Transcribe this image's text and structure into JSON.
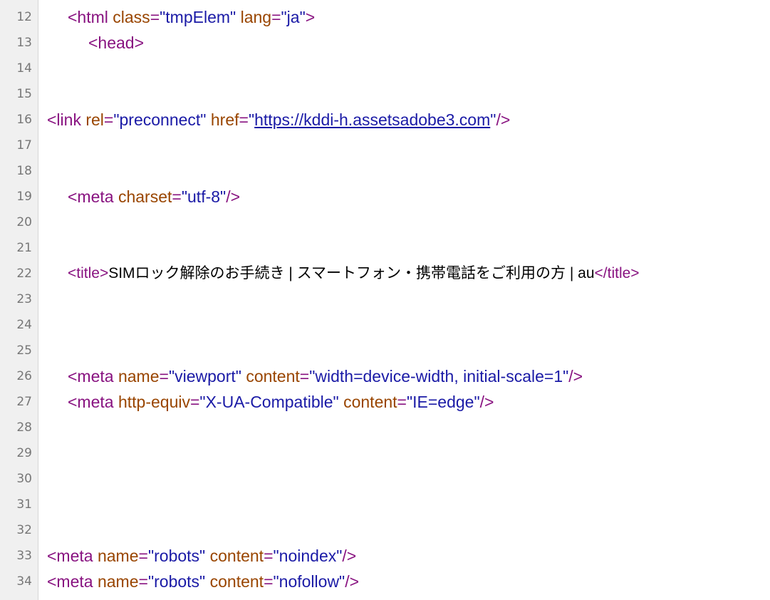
{
  "source": {
    "line_numbers": [
      "12",
      "13",
      "14",
      "15",
      "16",
      "17",
      "18",
      "19",
      "20",
      "21",
      "22",
      "23",
      "24",
      "25",
      "26",
      "27",
      "28",
      "29",
      "30",
      "31",
      "32",
      "33",
      "34"
    ],
    "html_open": {
      "tag_open": "<html",
      "attr1": "class",
      "val1": "\"tmpElem\"",
      "attr2": "lang",
      "val2": "\"ja\"",
      "tag_close": ">"
    },
    "head_open": "<head>",
    "link": {
      "tag_open": "<link",
      "attr1": "rel",
      "val1": "\"preconnect\"",
      "attr2": "href",
      "quote_open": "\"",
      "href": "https://kddi-h.assetsadobe3.com",
      "quote_close": "\"",
      "tag_close": "/>"
    },
    "meta_charset": {
      "tag_open": "<meta",
      "attr1": "charset",
      "val1": "\"utf-8\"",
      "tag_close": "/>"
    },
    "title": {
      "tag_open": "<title>",
      "text": "SIMロック解除のお手続き | スマートフォン・携帯電話をご利用の方 | au",
      "tag_close": "</title>"
    },
    "meta_viewport": {
      "tag_open": "<meta",
      "attr1": "name",
      "val1": "\"viewport\"",
      "attr2": "content",
      "val2": "\"width=device-width, initial-scale=1\"",
      "tag_close": "/>"
    },
    "meta_compat": {
      "tag_open": "<meta",
      "attr1": "http-equiv",
      "val1": "\"X-UA-Compatible\"",
      "attr2": "content",
      "val2": "\"IE=edge\"",
      "tag_close": "/>"
    },
    "meta_robots_1": {
      "tag_open": "<meta",
      "attr1": "name",
      "val1": "\"robots\"",
      "attr2": "content",
      "val2": "\"noindex\"",
      "tag_close": "/>"
    },
    "meta_robots_2": {
      "tag_open": "<meta",
      "attr1": "name",
      "val1": "\"robots\"",
      "attr2": "content",
      "val2": "\"nofollow\"",
      "tag_close": "/>"
    }
  },
  "colors": {
    "tag": "#881280",
    "attribute": "#994500",
    "value": "#1a1aa6",
    "gutter_bg": "#f0f0f0",
    "line_number": "#777777"
  }
}
